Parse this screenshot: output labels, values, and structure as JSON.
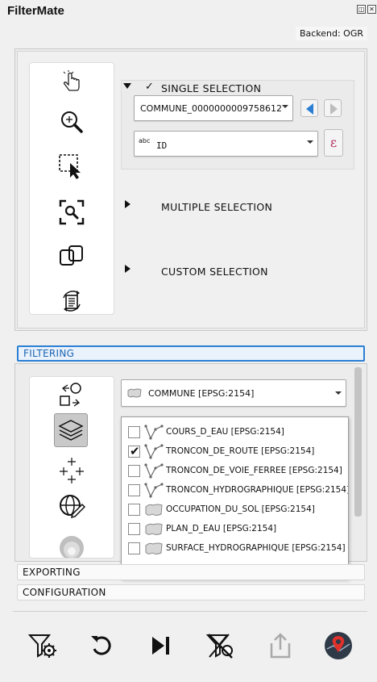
{
  "window": {
    "title": "FilterMate",
    "float_glyph": "◫",
    "close_glyph": "✕"
  },
  "backend": {
    "label": "Backend: OGR"
  },
  "exploring": {
    "tools": [
      {
        "icon": "pointer-hand-icon"
      },
      {
        "icon": "zoom-icon"
      },
      {
        "icon": "select-rectangle-icon"
      },
      {
        "icon": "zoom-to-selection-icon"
      },
      {
        "icon": "link-layers-icon"
      },
      {
        "icon": "reset-properties-icon"
      }
    ],
    "single_selection": {
      "title": "SINGLE SELECTION",
      "checked_glyph": "✓",
      "feature_value": "COMMUNE_0000000009758612",
      "field_type": "abc",
      "field_value": "ID",
      "expression_glyph": "ε"
    },
    "multiple_selection": {
      "title": "MULTIPLE SELECTION"
    },
    "custom_selection": {
      "title": "CUSTOM SELECTION"
    }
  },
  "sections": {
    "filtering": "FILTERING",
    "exporting": "EXPORTING",
    "configuration": "CONFIGURATION"
  },
  "filtering": {
    "source_layer": "COMMUNE [EPSG:2154]",
    "layers": [
      {
        "name": "COURS_D_EAU [EPSG:2154]",
        "checked": false,
        "geom": "line"
      },
      {
        "name": "TRONCON_DE_ROUTE [EPSG:2154]",
        "checked": true,
        "geom": "line"
      },
      {
        "name": "TRONCON_DE_VOIE_FERREE [EPSG:2154]",
        "checked": false,
        "geom": "line"
      },
      {
        "name": "TRONCON_HYDROGRAPHIQUE [EPSG:2154]",
        "checked": false,
        "geom": "line"
      },
      {
        "name": "OCCUPATION_DU_SOL [EPSG:2154]",
        "checked": false,
        "geom": "polygon"
      },
      {
        "name": "PLAN_D_EAU [EPSG:2154]",
        "checked": false,
        "geom": "polygon"
      },
      {
        "name": "SURFACE_HYDROGRAPHIQUE [EPSG:2154]",
        "checked": false,
        "geom": "polygon"
      }
    ]
  },
  "actions": [
    {
      "icon": "filter-settings-icon"
    },
    {
      "icon": "undo-icon"
    },
    {
      "icon": "skip-next-icon"
    },
    {
      "icon": "unfilter-icon"
    },
    {
      "icon": "export-icon",
      "disabled": true
    },
    {
      "icon": "about-map-pin-icon"
    }
  ],
  "colors": {
    "accent": "#2a7fd4",
    "pin_dark": "#2f3a48",
    "pin_red": "#e0312b"
  }
}
